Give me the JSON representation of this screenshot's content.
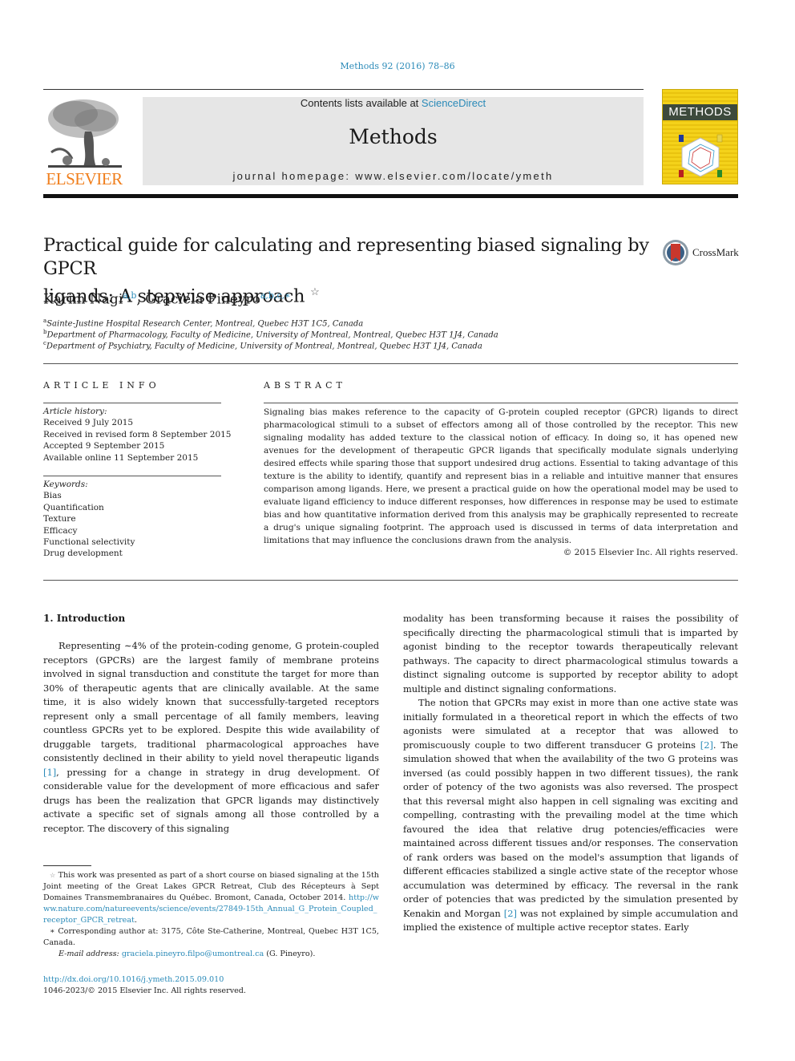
{
  "header": {
    "journal_ref": "Methods 92 (2016) 78–86",
    "contents_prefix": "Contents lists available at ",
    "contents_link": "ScienceDirect",
    "journal_name": "Methods",
    "homepage_prefix": "journal homepage: ",
    "homepage_url": "www.elsevier.com/locate/ymeth",
    "publisher_wordmark": "ELSEVIER",
    "cover_title": "METHODS",
    "crossmark_label": "CrossMark",
    "colors": {
      "link": "#2a8ab8",
      "elsevier_orange": "#f07f1d",
      "cover_yellow": "#f4d21a",
      "banner_gray": "#e6e6e6"
    }
  },
  "article": {
    "title_line1": "Practical guide for calculating and representing biased signaling by GPCR",
    "title_line2": "ligands: A stepwise approach",
    "title_mark": "☆",
    "authors": [
      {
        "name": "Karim Nagi",
        "affils": "a,b"
      },
      {
        "name": "Graciela Pineyro",
        "affils": "a,b,c,∗"
      }
    ],
    "affiliations": [
      {
        "key": "a",
        "text": "Sainte-Justine Hospital Research Center, Montreal, Quebec H3T 1C5, Canada"
      },
      {
        "key": "b",
        "text": "Department of Pharmacology, Faculty of Medicine, University of Montreal, Montreal, Quebec H3T 1J4, Canada"
      },
      {
        "key": "c",
        "text": "Department of Psychiatry, Faculty of Medicine, University of Montreal, Montreal, Quebec H3T 1J4, Canada"
      }
    ]
  },
  "article_info": {
    "heading": "ARTICLE INFO",
    "history_label": "Article history:",
    "history": [
      "Received 9 July 2015",
      "Received in revised form 8 September 2015",
      "Accepted 9 September 2015",
      "Available online 11 September 2015"
    ],
    "keywords_label": "Keywords:",
    "keywords": [
      "Bias",
      "Quantification",
      "Texture",
      "Efficacy",
      "Functional selectivity",
      "Drug development"
    ]
  },
  "abstract": {
    "heading": "ABSTRACT",
    "text": "Signaling bias makes reference to the capacity of G-protein coupled receptor (GPCR) ligands to direct pharmacological stimuli to a subset of effectors among all of those controlled by the receptor. This new signaling modality has added texture to the classical notion of efficacy. In doing so, it has opened new avenues for the development of therapeutic GPCR ligands that specifically modulate signals underlying desired effects while sparing those that support undesired drug actions. Essential to taking advantage of this texture is the ability to identify, quantify and represent bias in a reliable and intuitive manner that ensures comparison among ligands. Here, we present a practical guide on how the operational model may be used to evaluate ligand efficiency to induce different responses, how differences in response may be used to estimate bias and how quantitative information derived from this analysis may be graphically represented to recreate a drug's unique signaling footprint. The approach used is discussed in terms of data interpretation and limitations that may influence the conclusions drawn from the analysis.",
    "copyright": "© 2015 Elsevier Inc. All rights reserved."
  },
  "body": {
    "intro_heading": "1. Introduction",
    "left_p1_a": "Representing ∼4% of the protein-coding genome, G protein-coupled receptors (GPCRs) are the largest family of membrane proteins involved in signal transduction and constitute the target for more than 30% of therapeutic agents that are clinically available. At the same time, it is also widely known that successfully-targeted receptors represent only a small percentage of all family members, leaving countless GPCRs yet to be explored. Despite this wide availability of druggable targets, traditional pharmacological approaches have consistently declined in their ability to yield novel therapeutic ligands ",
    "left_p1_ref": "[1]",
    "left_p1_b": ", pressing for a change in strategy in drug development. Of considerable value for the development of more efficacious and safer drugs has been the realization that GPCR ligands may distinctively activate a specific set of signals among all those controlled by a receptor. The discovery of this signaling",
    "right_p1": "modality has been transforming because it raises the possibility of specifically directing the pharmacological stimuli that is imparted by agonist binding to the receptor towards therapeutically relevant pathways. The capacity to direct pharmacological stimulus towards a distinct signaling outcome is supported by receptor ability to adopt multiple and distinct signaling conformations.",
    "right_p2_a": "The notion that GPCRs may exist in more than one active state was initially formulated in a theoretical report in which the effects of two agonists were simulated at a receptor that was allowed to promiscuously couple to two different transducer G proteins ",
    "right_p2_ref1": "[2]",
    "right_p2_b": ". The simulation showed that when the availability of the two G proteins was inversed (as could possibly happen in two different tissues), the rank order of potency of the two agonists was also reversed. The prospect that this reversal might also happen in cell signaling was exciting and compelling, contrasting with the prevailing model at the time which favoured the idea that relative drug potencies/efficacies were maintained across different tissues and/or responses. The conservation of rank orders was based on the model's assumption that ligands of different efficacies stabilized a single active state of the receptor whose accumulation was determined by efficacy. The reversal in the rank order of potencies that was predicted by the simulation presented by Kenakin and Morgan ",
    "right_p2_ref2": "[2]",
    "right_p2_c": " was not explained by simple accumulation and implied the existence of multiple active receptor states. Early"
  },
  "footnotes": {
    "star_mark": "☆",
    "star_text": "This work was presented as part of a short course on biased signaling at the 15th Joint meeting of the Great Lakes GPCR Retreat, Club des Récepteurs à Sept Domaines Transmembranaires du Québec. Bromont, Canada, October 2014. ",
    "star_link": "http://www.nature.com/natureevents/science/events/27849-15th_Annual_G_Protein_Coupled_receptor_GPCR_retreat",
    "star_end": ".",
    "corr_mark": "∗",
    "corr_text": "Corresponding author at: 3175, Côte Ste-Catherine, Montreal, Quebec H3T 1C5, Canada.",
    "email_label": "E-mail address: ",
    "email": "graciela.pineyro.filpo@umontreal.ca",
    "email_suffix": " (G. Pineyro)."
  },
  "footer": {
    "doi": "http://dx.doi.org/10.1016/j.ymeth.2015.09.010",
    "issn": "1046-2023/© 2015 Elsevier Inc. All rights reserved."
  }
}
